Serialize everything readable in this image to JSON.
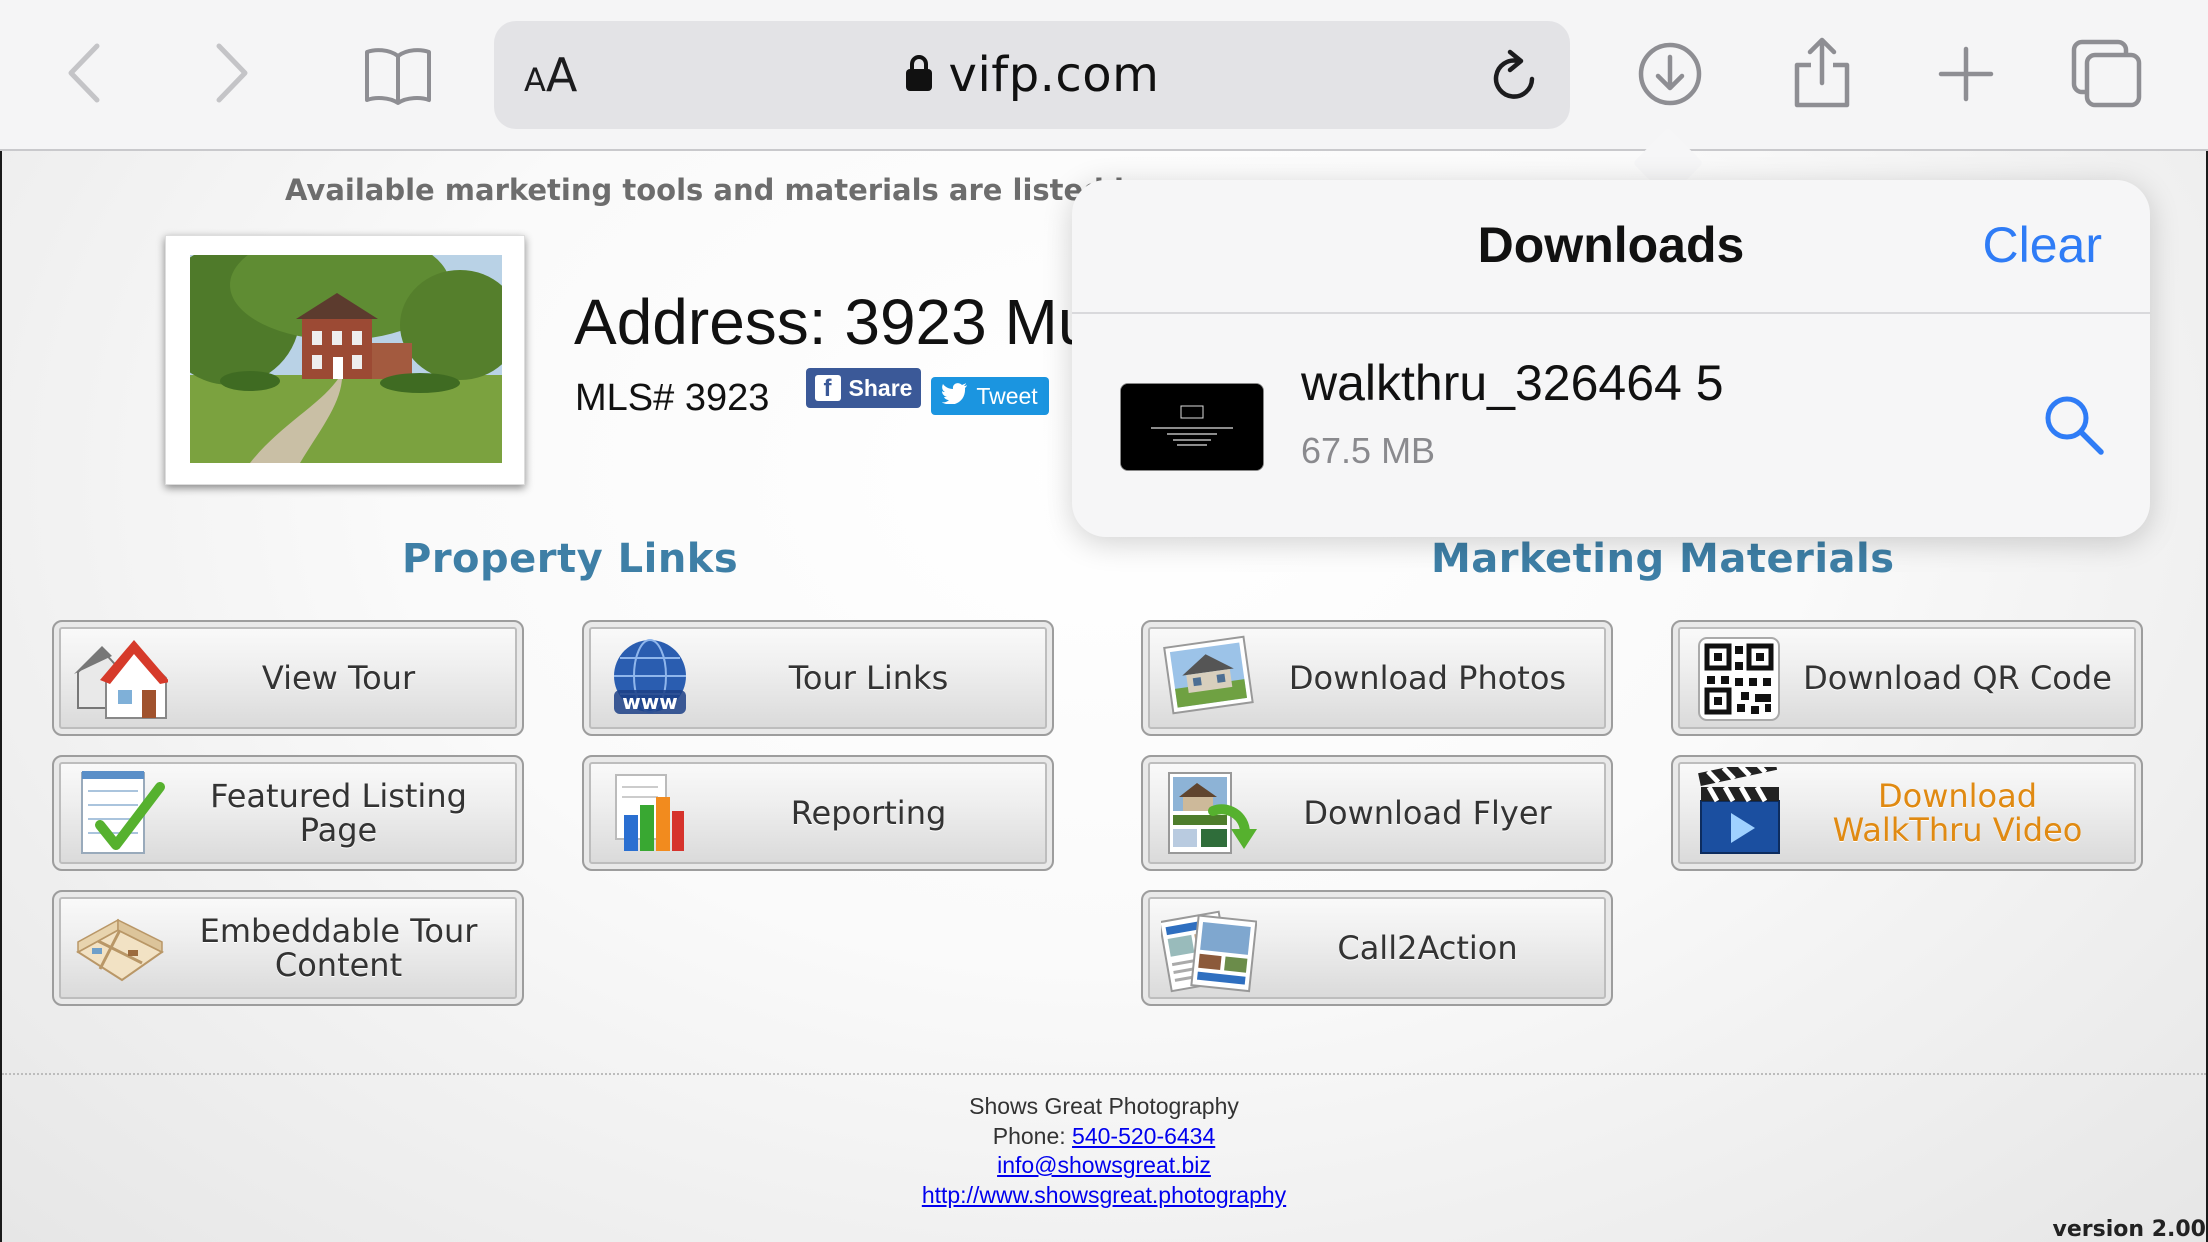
{
  "toolbar": {
    "url": "vifp.com",
    "text_size_small": "A",
    "text_size_large": "A"
  },
  "page": {
    "notice": "Available marketing tools and materials are listed b",
    "address": "Address: 3923 Mu",
    "mls": "MLS# 3923",
    "share_label": "Share",
    "tweet_label": "Tweet",
    "property_links_title": "Property Links",
    "marketing_title": "Marketing Materials",
    "property_links": [
      "View Tour",
      "Tour Links",
      "Featured Listing Page",
      "Reporting",
      "Embeddable Tour Content"
    ],
    "marketing": [
      "Download Photos",
      "Download QR Code",
      "Download Flyer",
      "Download WalkThru Video",
      "Call2Action"
    ],
    "footer": {
      "company": "Shows Great Photography",
      "phone_label": "Phone: ",
      "phone": "540-520-6434",
      "email": "info@showsgreat.biz",
      "website": "http://www.showsgreat.photography"
    },
    "version": "version 2.00"
  },
  "downloads": {
    "title": "Downloads",
    "clear_label": "Clear",
    "items": [
      {
        "name": "walkthru_326464 5",
        "size": "67.5 MB"
      }
    ]
  },
  "colors": {
    "accent_blue": "#2f7cf6",
    "section_title": "#3e7fa6",
    "facebook": "#3b5998",
    "twitter": "#1b95e0",
    "walkthru_label": "#e08a12"
  }
}
